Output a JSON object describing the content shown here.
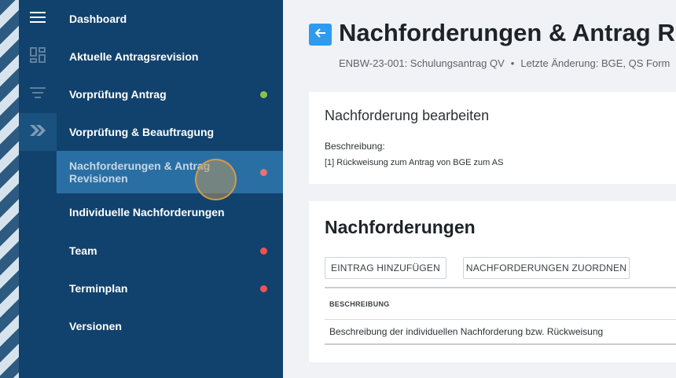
{
  "sidebar": {
    "rail_icons": [
      "menu-icon",
      "dashboard-icon",
      "list-filter-icon",
      "double-chevron-right-icon"
    ],
    "items": [
      {
        "label": "Dashboard",
        "dot": ""
      },
      {
        "label": "Aktuelle Antragsrevision",
        "dot": ""
      },
      {
        "label": "Vorprüfung Antrag",
        "dot": "#8bc34a"
      },
      {
        "label": "Vorprüfung & Beauftragung",
        "dot": ""
      },
      {
        "label": "Nachforderungen & Antrag Revisionen",
        "dot": "#e57373"
      },
      {
        "label": "Individuelle Nachforderungen",
        "dot": ""
      },
      {
        "label": "Team",
        "dot": "#ef5350"
      },
      {
        "label": "Terminplan",
        "dot": "#ef5350"
      },
      {
        "label": "Versionen",
        "dot": ""
      }
    ]
  },
  "header": {
    "title": "Nachforderungen & Antrag Re",
    "subtitle_id": "ENBW-23-001: Schulungsantrag QV",
    "subtitle_sep": "•",
    "subtitle_change": "Letzte Änderung: BGE, QS Form"
  },
  "edit_card": {
    "title": "Nachforderung bearbeiten",
    "description_label": "Beschreibung:",
    "description_value": "[1] Rückweisung zum Antrag von BGE zum AS"
  },
  "list_card": {
    "title": "Nachforderungen",
    "add_button": "EINTRAG HINZUFÜGEN",
    "assign_button": "NACHFORDERUNGEN ZUORDNEN",
    "column_header": "BESCHREIBUNG",
    "rows": [
      "Beschreibung der individuellen Nachforderung bzw. Rückweisung"
    ]
  },
  "colors": {
    "sidebar_bg": "#11426d",
    "active_item_bg": "#2a6fa4",
    "back_button": "#2d9bf0",
    "dot_green": "#8bc34a",
    "dot_red": "#ef5350"
  }
}
